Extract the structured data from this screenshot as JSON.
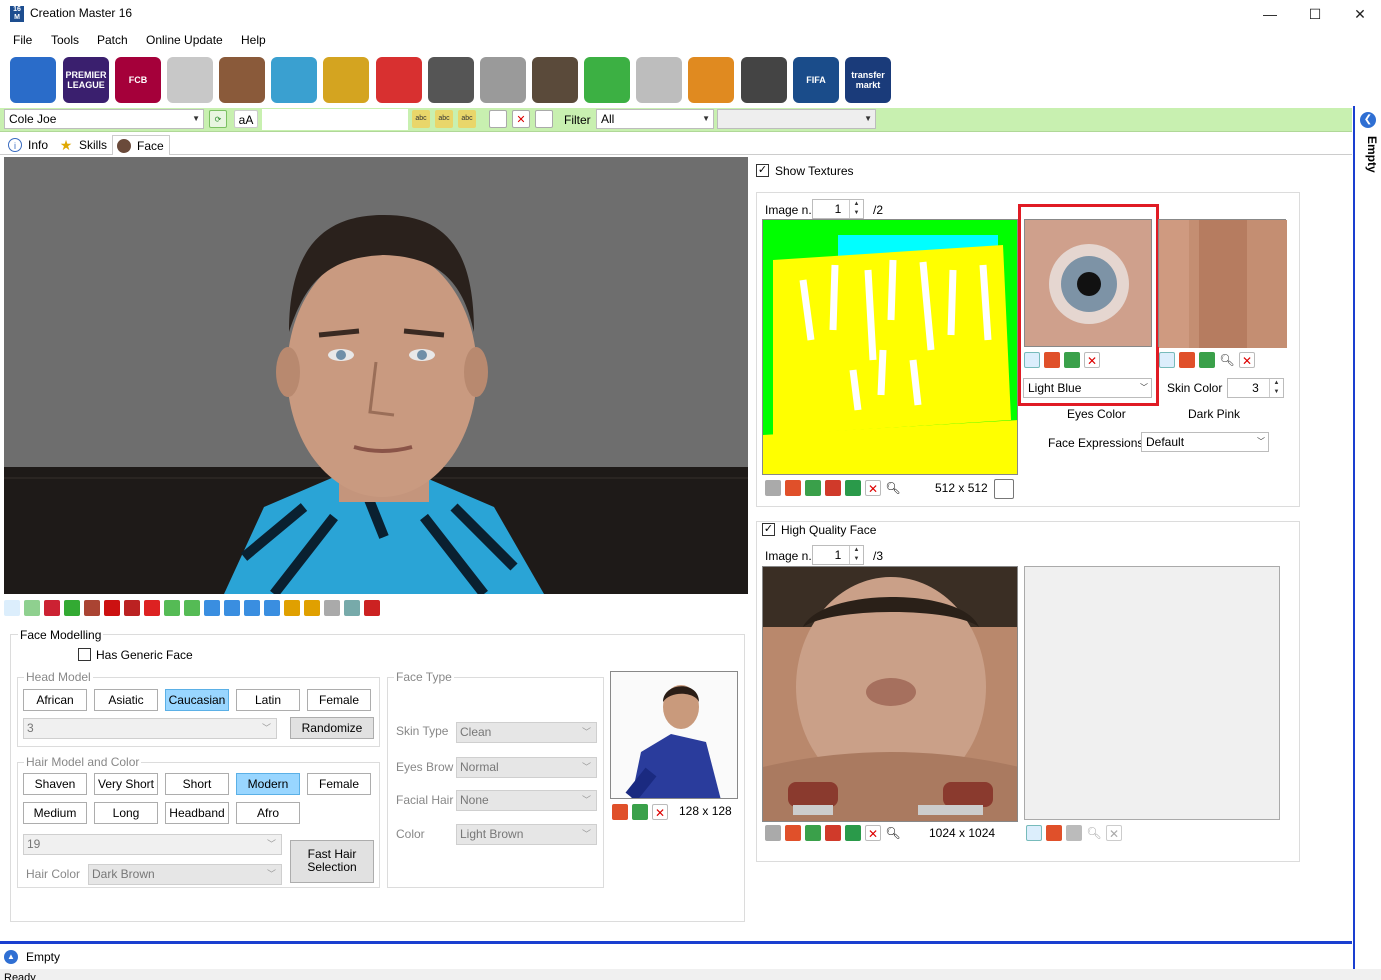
{
  "window": {
    "title": "Creation Master 16",
    "minimize": "—",
    "maximize": "☐",
    "close": "✕"
  },
  "menu": [
    "File",
    "Tools",
    "Patch",
    "Online Update",
    "Help"
  ],
  "toolbar_icons": [
    {
      "name": "globe-icon",
      "label": "",
      "color": "#2a6cc9"
    },
    {
      "name": "premier-league-icon",
      "label": "PREMIER LEAGUE",
      "color": "#3a1f6e"
    },
    {
      "name": "barcelona-crest-icon",
      "label": "FCB",
      "color": "#a5003a"
    },
    {
      "name": "jersey-icon",
      "label": "",
      "color": "#c8c8c8"
    },
    {
      "name": "player-photo-icon",
      "label": "",
      "color": "#8a5a3a"
    },
    {
      "name": "stadium-icon",
      "label": "",
      "color": "#3aa0d0"
    },
    {
      "name": "trophy-icon",
      "label": "",
      "color": "#d4a420"
    },
    {
      "name": "referee-cards-icon",
      "label": "",
      "color": "#d83030"
    },
    {
      "name": "ball-icon",
      "label": "",
      "color": "#555555"
    },
    {
      "name": "boots-icon",
      "label": "",
      "color": "#9a9a9a"
    },
    {
      "name": "manager-icon",
      "label": "",
      "color": "#5a4a3a"
    },
    {
      "name": "pitch-icon",
      "label": "",
      "color": "#3cb043"
    },
    {
      "name": "newspaper-icon",
      "label": "",
      "color": "#bdbdbd"
    },
    {
      "name": "gloves-icon",
      "label": "",
      "color": "#e08a20"
    },
    {
      "name": "headphones-icon",
      "label": "",
      "color": "#444444"
    },
    {
      "name": "fifa-cover-icon",
      "label": "FIFA",
      "color": "#1a4c8a"
    },
    {
      "name": "transfermarkt-icon",
      "label": "transfer markt",
      "color": "#1a3b7a"
    }
  ],
  "filterbar": {
    "player": "Cole Joe",
    "case_label": "aA",
    "filter_label": "Filter",
    "filter_value": "All",
    "secondary_value": ""
  },
  "tabs": [
    {
      "label": "Info",
      "icon": "info-icon"
    },
    {
      "label": "Skills",
      "icon": "star-icon"
    },
    {
      "label": "Face",
      "icon": "face-icon"
    }
  ],
  "right_strip": {
    "label": "Empty"
  },
  "face_modelling": {
    "title": "Face Modelling",
    "generic_face": "Has Generic Face",
    "head_model": {
      "title": "Head Model",
      "buttons": [
        "African",
        "Asiatic",
        "Caucasian",
        "Latin",
        "Female"
      ],
      "selected": "Caucasian",
      "value": "3",
      "randomize": "Randomize"
    },
    "hair": {
      "title": "Hair Model and Color",
      "row1": [
        "Shaven",
        "Very Short",
        "Short",
        "Modern",
        "Female"
      ],
      "row2": [
        "Medium",
        "Long",
        "Headband",
        "Afro"
      ],
      "selected": "Modern",
      "value": "19",
      "fast": "Fast Hair Selection",
      "color_label": "Hair Color",
      "color_value": "Dark Brown"
    },
    "face_type": {
      "title": "Face Type",
      "skin_label": "Skin Type",
      "skin_value": "Clean",
      "brow_label": "Eyes Brow",
      "brow_value": "Normal",
      "facial_label": "Facial Hair",
      "facial_value": "None",
      "color_label": "Color",
      "color_value": "Light Brown"
    },
    "photo_size": "128 x 128"
  },
  "textures": {
    "show_label": "Show Textures",
    "image_label": "Image n.",
    "image_n": "1",
    "image_total": "/2",
    "size": "512 x 512",
    "eyes_color_value": "Light Blue",
    "eyes_color_label": "Eyes Color",
    "skin_color_label": "Skin Color",
    "skin_color_value": "3",
    "skin_color_name": "Dark Pink",
    "expressions_label": "Face Expressions",
    "expressions_value": "Default"
  },
  "hq_face": {
    "label": "High Quality Face",
    "image_label": "Image n.",
    "image_n": "1",
    "image_total": "/3",
    "size": "1024 x 1024"
  },
  "status": {
    "panel": "Empty",
    "text": "Ready"
  },
  "colors": {
    "highlight": "#e01b24",
    "selected_button": "#99d6ff",
    "filterbar": "#c8f0b0",
    "status_border": "#1a3fd0"
  }
}
